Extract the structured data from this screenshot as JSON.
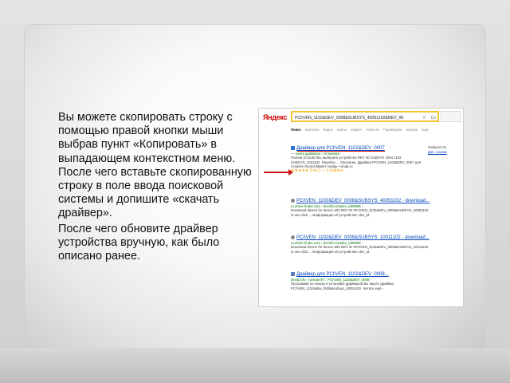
{
  "paragraphs": [
    "Вы можете скопировать строку с помощью правой кнопки мыши выбрав пункт «Копировать» в выпадающем контекстном меню. После чего вставьте скопированную строку в поле ввода поисковой системы и допишите «скачать драйвер».",
    "После чего обновите драйвер устройства вручную, как было описано ранее."
  ],
  "screenshot": {
    "logo": "Яндекс",
    "search_value": "PCI\\VEN_1102&DEV_0008&SUBSYS_40051102&REV_00",
    "tabs": [
      "Поиск",
      "Картинки",
      "Видео",
      "Карты",
      "Маркет",
      "Новости",
      "Переводчик",
      "Музыка",
      "Ещё"
    ],
    "sidebar_lines": [
      "Nvidiplus Su",
      "Доп. ссылки"
    ],
    "results": [
      {
        "title": "Драйвер для PCI\\VEN_1102&DEV_0007",
        "url": "— поиск драйвера › Установка",
        "snippet": "Поиски устройства, выберите устройство REV 00 SUBSYS 1004 1102 SUBSYS_1021102. Перейти ... Описание. Драйвер PCI\\VEN_1102&DEV_0007 для Creative Sound Blaster Audigy • vindg.ru",
        "rating": "★★★★★ 5 из 1 — 1 оценка"
      },
      {
        "title": "PCI\\VEN_1102&DEV_0008&SUBSYS_40051102 - download...",
        "url": "ru.driver-finder.com › devinfo-intodev_id09906 ›",
        "snippet": "Download drivers for device with DEV ID PCI\\VEN_1102&DEV_0008&SUBSYS_40051102 in one click ... Информация об устройстве: dev_id."
      },
      {
        "title": "PCI\\VEN_1102&DEV_0008&SUBSYS_10011102 - download...",
        "url": "ru.driver-finder.com › devinfo-intodev_id09906 ›",
        "snippet": "Download drivers for device with DEV ID PCI\\VEN_1102&DEV_0008&SUBSYS_10011102 in one click ... Информация об устройстве: dev_id."
      },
      {
        "title": "Драйвер для PCI\\VEN_1102&DEV_0008...",
        "url": "devid.info › ru/search?.. PCI\\VEN_1102&DEV_0008 ›",
        "snippet": "Программа по поиску и установке драйверов Вы ищете драйвер PCI\\VEN_1102&dev_0008&subsys_40051102. Читать ещё ›"
      }
    ]
  }
}
